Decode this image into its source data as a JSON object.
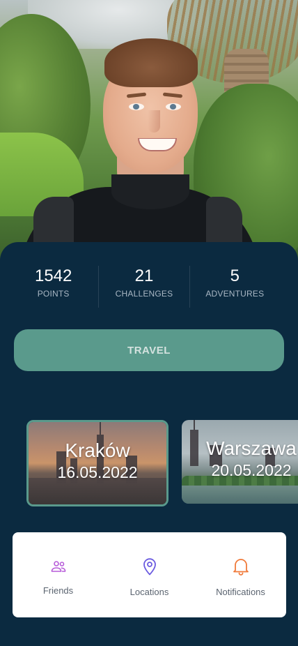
{
  "stats": [
    {
      "value": "1542",
      "label": "POINTS"
    },
    {
      "value": "21",
      "label": "CHALLENGES"
    },
    {
      "value": "5",
      "label": "ADVENTURES"
    }
  ],
  "travel_button": {
    "label": "TRAVEL"
  },
  "cities": [
    {
      "name": "Kraków",
      "date": "16.05.2022",
      "selected": true
    },
    {
      "name": "Warszawa",
      "date": "20.05.2022",
      "selected": false
    }
  ],
  "nav": [
    {
      "label": "Friends",
      "icon": "friends-icon",
      "color": "#b75cd9"
    },
    {
      "label": "Locations",
      "icon": "location-pin-icon",
      "color": "#6b5be0"
    },
    {
      "label": "Notifications",
      "icon": "bell-icon",
      "color": "#f07a3a"
    }
  ],
  "colors": {
    "background": "#0b2a40",
    "accent": "#5a9a8c",
    "nav_background": "#ffffff"
  }
}
